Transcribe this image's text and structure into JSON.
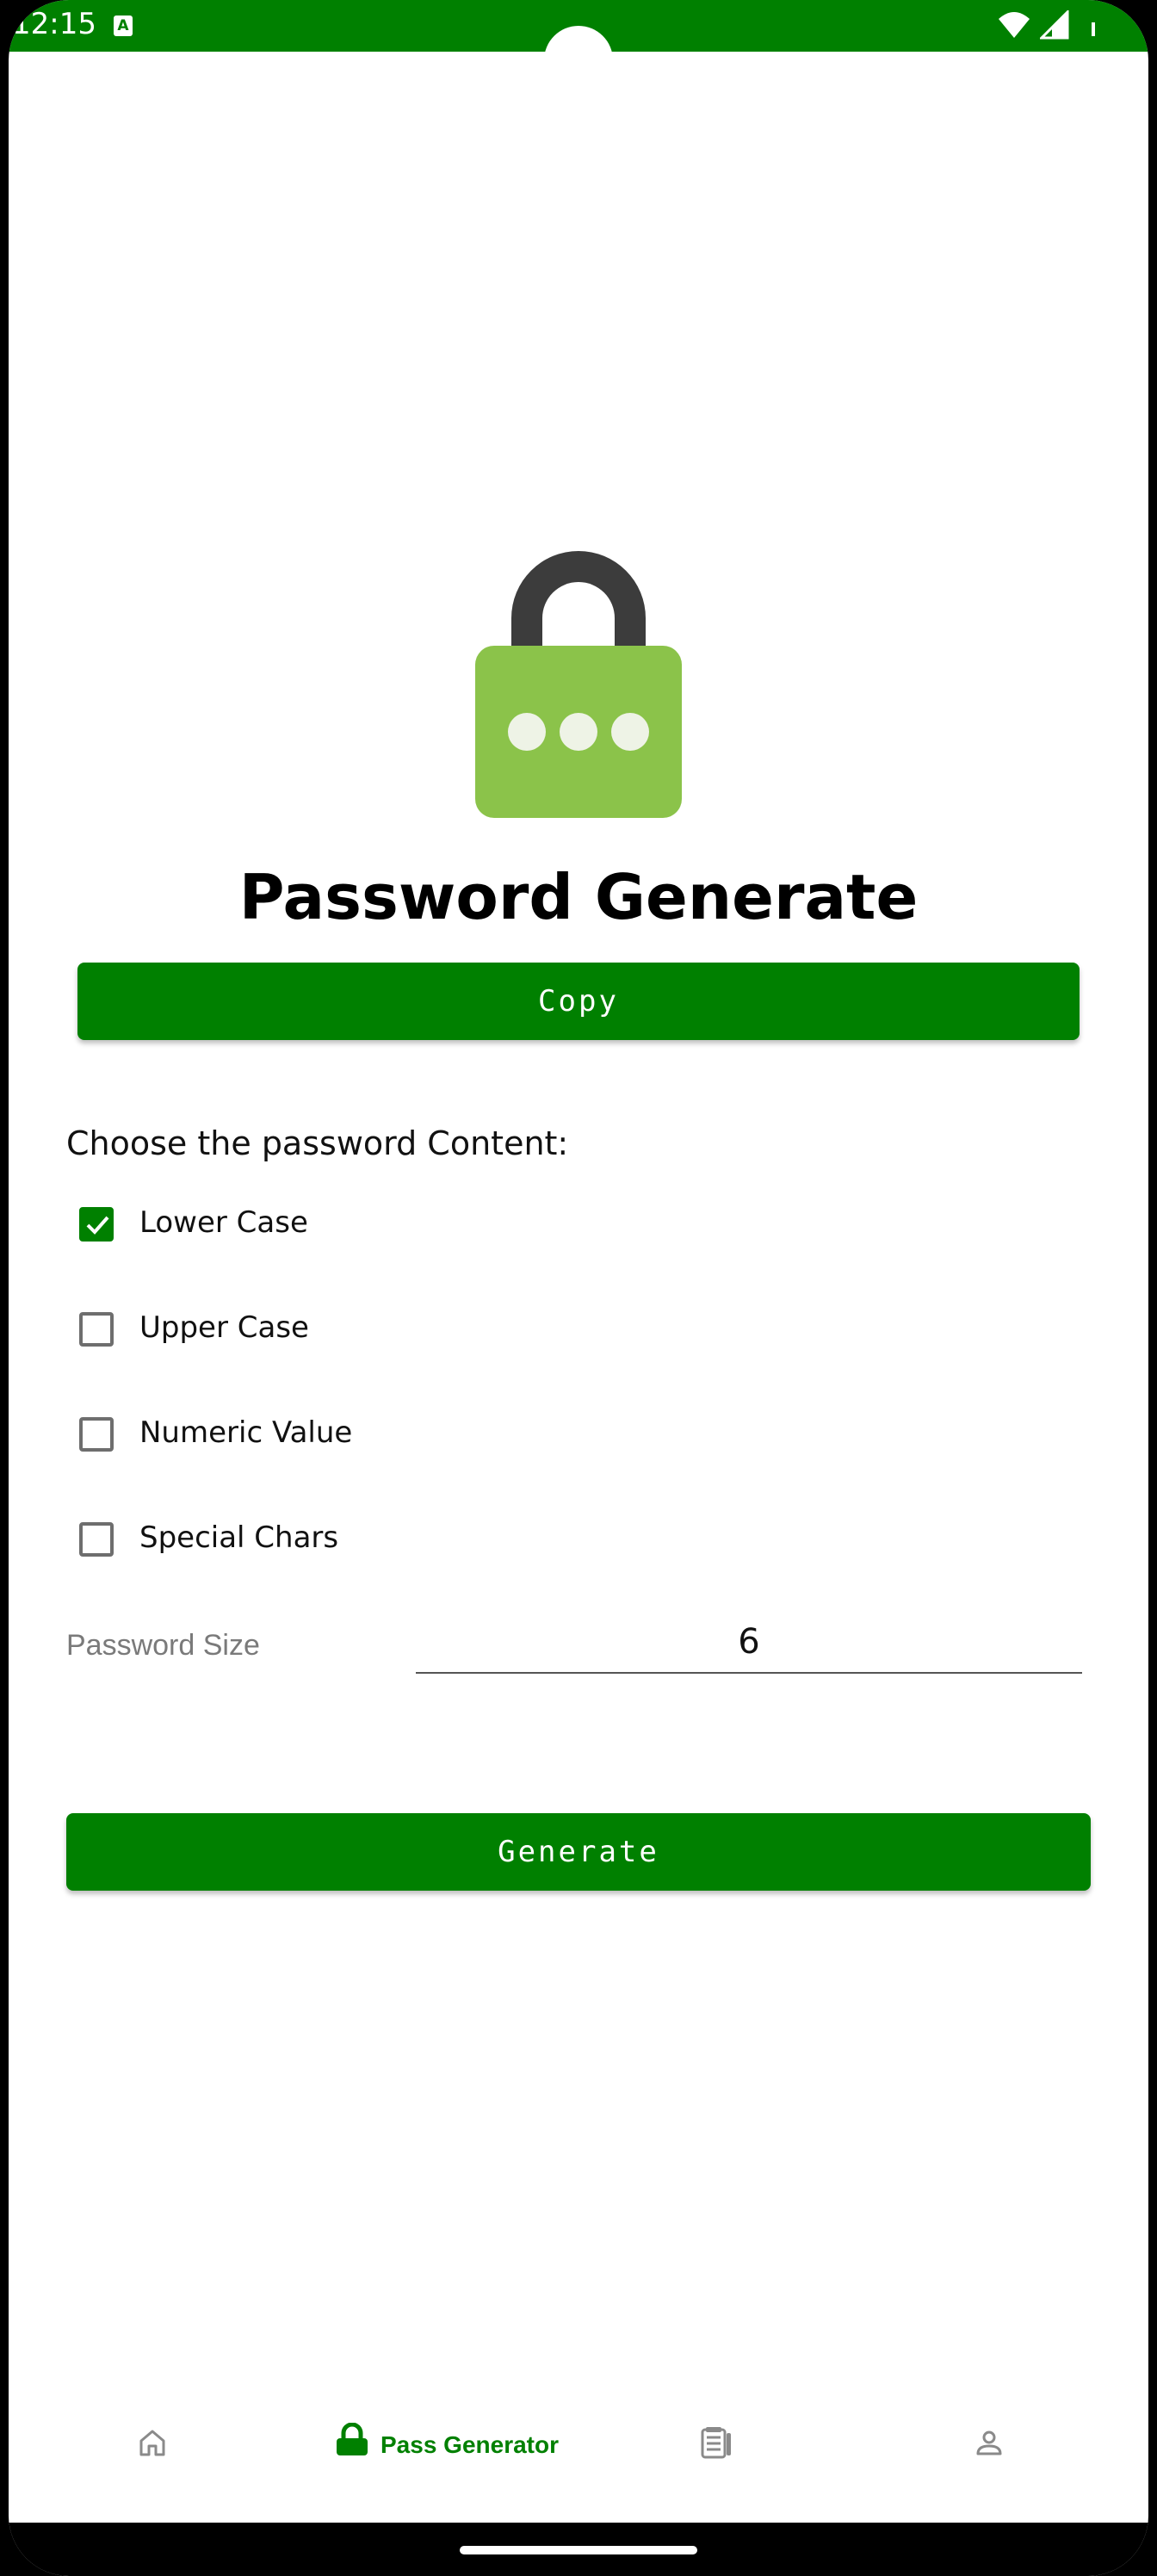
{
  "status_bar": {
    "time": "12:15",
    "notification_icon": "A",
    "icons": [
      "wifi-icon",
      "signal-icon",
      "battery-icon"
    ],
    "color": "#008000"
  },
  "header": {
    "illustration": "lock-icon",
    "title": "Password Generate"
  },
  "actions": {
    "copy_label": "Copy",
    "generate_label": "Generate"
  },
  "options": {
    "heading": "Choose the password Content:",
    "items": [
      {
        "label": "Lower Case",
        "checked": true
      },
      {
        "label": "Upper Case",
        "checked": false
      },
      {
        "label": "Numeric Value",
        "checked": false
      },
      {
        "label": "Special Chars",
        "checked": false
      }
    ]
  },
  "password_size": {
    "label": "Password Size",
    "value": "6"
  },
  "bottom_nav": {
    "items": [
      {
        "icon": "home-icon",
        "label": "",
        "active": false
      },
      {
        "icon": "lock-icon",
        "label": "Pass Generator",
        "active": true
      },
      {
        "icon": "notes-icon",
        "label": "",
        "active": false
      },
      {
        "icon": "person-icon",
        "label": "",
        "active": false
      }
    ]
  },
  "colors": {
    "accent": "#008000",
    "lock_body": "#8BC34A",
    "lock_shackle": "#3C3C3C"
  }
}
